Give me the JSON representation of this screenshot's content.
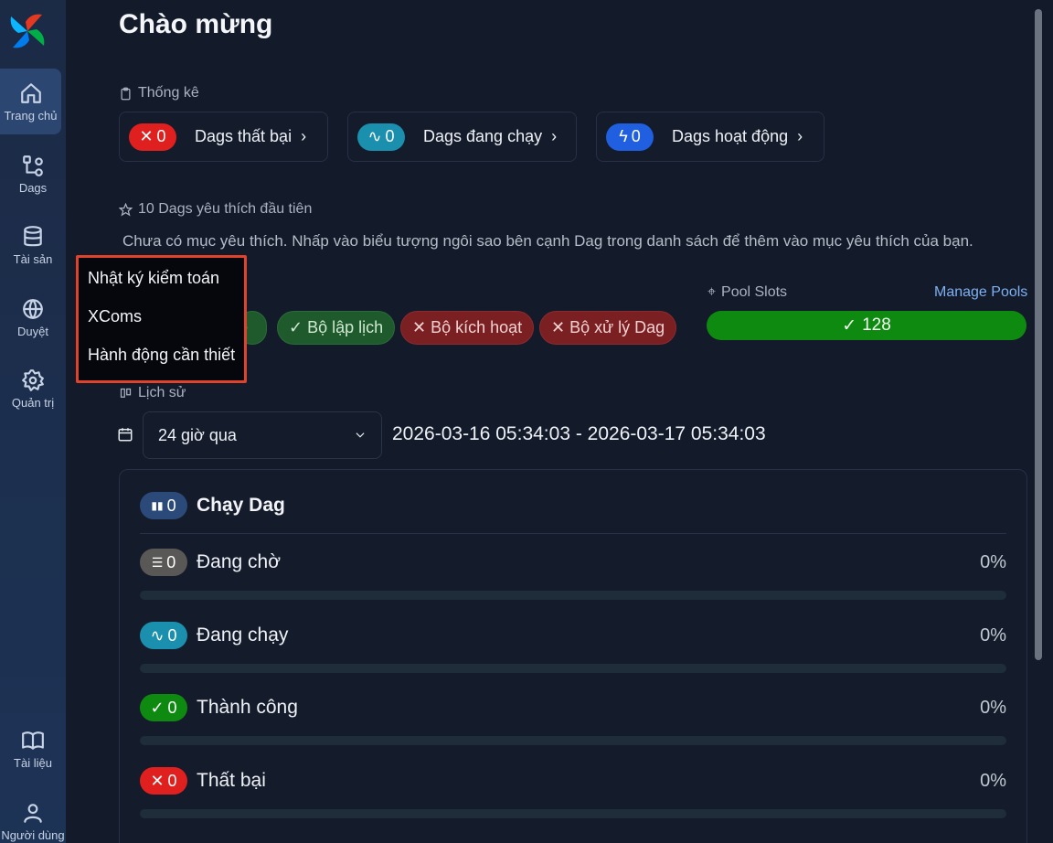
{
  "sidebar": {
    "items": [
      {
        "label": "Trang chủ",
        "icon": "home-icon"
      },
      {
        "label": "Dags",
        "icon": "dag-icon"
      },
      {
        "label": "Tài sản",
        "icon": "database-icon"
      },
      {
        "label": "Duyệt",
        "icon": "globe-icon"
      },
      {
        "label": "Quản trị",
        "icon": "gear-icon"
      },
      {
        "label": "Tài liệu",
        "icon": "book-icon"
      },
      {
        "label": "Người dùng",
        "icon": "user-icon"
      }
    ]
  },
  "header": {
    "title": "Chào mừng"
  },
  "stats": {
    "label": "Thống kê",
    "cards": [
      {
        "count": "0",
        "label": "Dags thất bại",
        "color": "#e0201f"
      },
      {
        "count": "0",
        "label": "Dags đang chạy",
        "color": "#1b8fae"
      },
      {
        "count": "0",
        "label": "Dags hoạt động",
        "color": "#1f5fe0"
      }
    ]
  },
  "favorites": {
    "label": "10 Dags yêu thích đầu tiên",
    "empty_message": "Chưa có mục yêu thích. Nhấp vào biểu tượng ngôi sao bên cạnh Dag trong danh sách để thêm vào mục yêu thích của bạn."
  },
  "health": {
    "pills": [
      {
        "label": "e",
        "status": "ok"
      },
      {
        "label": "Bộ lập lịch",
        "status": "ok"
      },
      {
        "label": "Bộ kích hoạt",
        "status": "bad"
      },
      {
        "label": "Bộ xử lý Dag",
        "status": "bad"
      }
    ]
  },
  "pools": {
    "label": "Pool Slots",
    "manage_label": "Manage Pools",
    "value": "128",
    "color": "#0e8a10"
  },
  "history": {
    "label": "Lịch sử",
    "range_select": "24 giờ qua",
    "date_range": "2026-03-16 05:34:03 - 2026-03-17 05:34:03"
  },
  "dag_runs": {
    "title": "Chạy Dag",
    "total": "0",
    "rows": [
      {
        "count": "0",
        "label": "Đang chờ",
        "percent": "0%",
        "color": "#5a5856",
        "progress": 0
      },
      {
        "count": "0",
        "label": "Đang chạy",
        "percent": "0%",
        "color": "#1b8fae",
        "progress": 0
      },
      {
        "count": "0",
        "label": "Thành công",
        "percent": "0%",
        "color": "#0e8a10",
        "progress": 0
      },
      {
        "count": "0",
        "label": "Thất bại",
        "percent": "0%",
        "color": "#e0201f",
        "progress": 0
      }
    ]
  },
  "menu": {
    "items": [
      "Nhật ký kiểm toán",
      "XComs",
      "Hành động cần thiết"
    ]
  }
}
